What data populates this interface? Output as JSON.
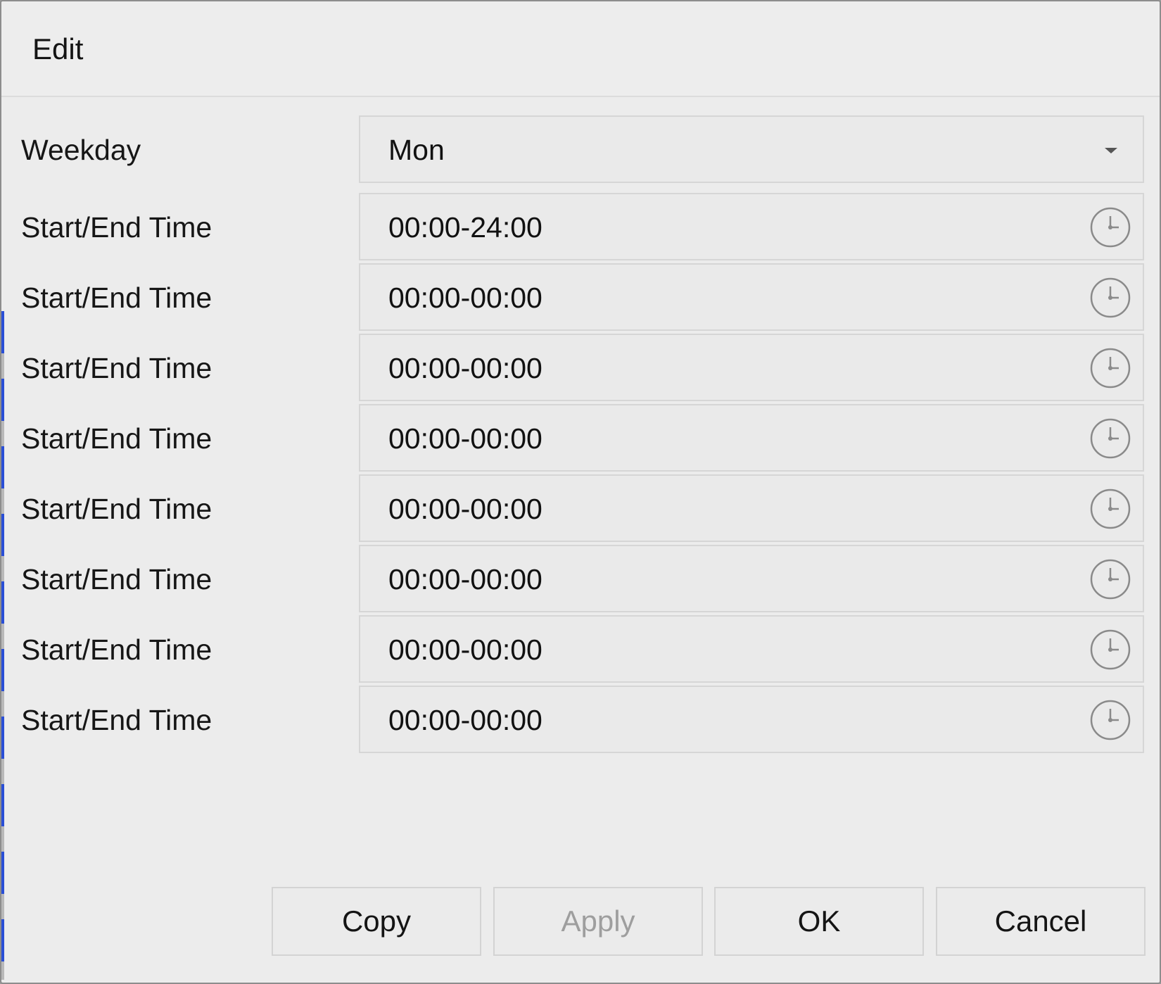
{
  "dialog": {
    "title": "Edit",
    "weekday": {
      "label": "Weekday",
      "value": "Mon"
    },
    "time_rows": [
      {
        "label": "Start/End Time",
        "value": "00:00-24:00"
      },
      {
        "label": "Start/End Time",
        "value": "00:00-00:00"
      },
      {
        "label": "Start/End Time",
        "value": "00:00-00:00"
      },
      {
        "label": "Start/End Time",
        "value": "00:00-00:00"
      },
      {
        "label": "Start/End Time",
        "value": "00:00-00:00"
      },
      {
        "label": "Start/End Time",
        "value": "00:00-00:00"
      },
      {
        "label": "Start/End Time",
        "value": "00:00-00:00"
      },
      {
        "label": "Start/End Time",
        "value": "00:00-00:00"
      }
    ],
    "buttons": {
      "copy": "Copy",
      "apply": "Apply",
      "ok": "OK",
      "cancel": "Cancel"
    },
    "icons": {
      "time_picker": "clock-icon",
      "dropdown": "chevron-down-icon"
    }
  }
}
